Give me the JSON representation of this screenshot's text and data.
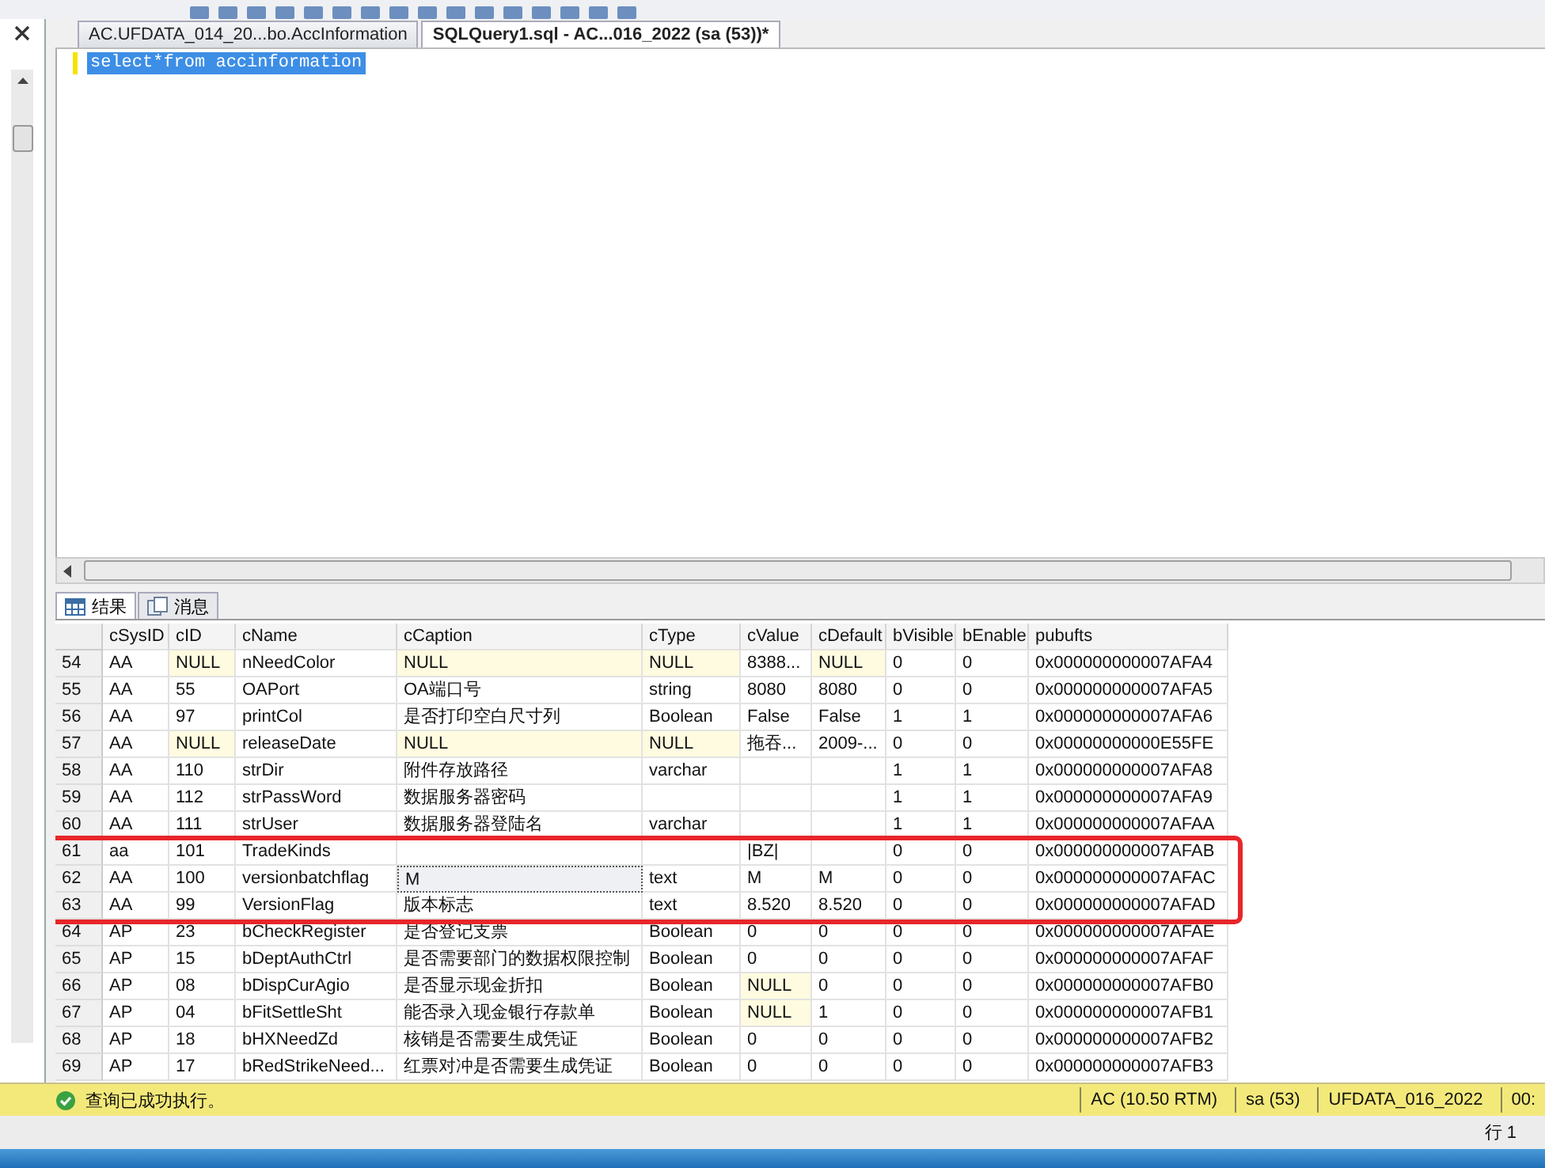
{
  "tabs": [
    {
      "label": "AC.UFDATA_014_20...bo.AccInformation",
      "selected": false
    },
    {
      "label": "SQLQuery1.sql - AC...016_2022 (sa (53))*",
      "selected": true
    }
  ],
  "editor": {
    "query": "select*from accinformation",
    "selected": true
  },
  "result_tabs": [
    {
      "label": "结果",
      "kind": "grid",
      "selected": true
    },
    {
      "label": "消息",
      "kind": "messages",
      "selected": false
    }
  ],
  "table": {
    "columns": [
      "cSysID",
      "cID",
      "cName",
      "cCaption",
      "cType",
      "cValue",
      "cDefault",
      "bVisible",
      "bEnable",
      "pubufts"
    ],
    "rows": [
      {
        "number": "54",
        "cells": [
          "AA",
          {
            "text": "NULL",
            "null": true,
            "focused": false
          },
          "nNeedColor",
          {
            "text": "NULL",
            "null": true,
            "focused": false
          },
          {
            "text": "NULL",
            "null": true,
            "focused": false
          },
          "8388...",
          {
            "text": "NULL",
            "null": true,
            "focused": false
          },
          "0",
          "0",
          "0x000000000007AFA4"
        ]
      },
      {
        "number": "55",
        "cells": [
          "AA",
          "55",
          "OAPort",
          "OA端口号",
          "string",
          "8080",
          "8080",
          "0",
          "0",
          "0x000000000007AFA5"
        ]
      },
      {
        "number": "56",
        "cells": [
          "AA",
          "97",
          "printCol",
          "是否打印空白尺寸列",
          "Boolean",
          "False",
          "False",
          "1",
          "1",
          "0x000000000007AFA6"
        ]
      },
      {
        "number": "57",
        "cells": [
          "AA",
          {
            "text": "NULL",
            "null": true,
            "focused": false
          },
          "releaseDate",
          {
            "text": "NULL",
            "null": true,
            "focused": false
          },
          {
            "text": "NULL",
            "null": true,
            "focused": false
          },
          "拖吞...",
          "2009-...",
          "0",
          "0",
          "0x00000000000E55FE"
        ]
      },
      {
        "number": "58",
        "cells": [
          "AA",
          "110",
          "strDir",
          "附件存放路径",
          "varchar",
          null,
          null,
          "1",
          "1",
          "0x000000000007AFA8"
        ]
      },
      {
        "number": "59",
        "cells": [
          "AA",
          "112",
          "strPassWord",
          "数据服务器密码",
          null,
          null,
          null,
          "1",
          "1",
          "0x000000000007AFA9"
        ]
      },
      {
        "number": "60",
        "cells": [
          "AA",
          "111",
          "strUser",
          "数据服务器登陆名",
          "varchar",
          null,
          null,
          "1",
          "1",
          "0x000000000007AFAA"
        ]
      },
      {
        "number": "61",
        "cells": [
          "aa",
          "101",
          "TradeKinds",
          null,
          null,
          "|BZ|",
          null,
          "0",
          "0",
          "0x000000000007AFAB"
        ]
      },
      {
        "number": "62",
        "cells": [
          "AA",
          "100",
          "versionbatchflag",
          {
            "text": "M",
            "focused": true
          },
          "text",
          "M",
          "M",
          "0",
          "0",
          "0x000000000007AFAC"
        ]
      },
      {
        "number": "63",
        "cells": [
          "AA",
          "99",
          "VersionFlag",
          "版本标志",
          "text",
          "8.520",
          "8.520",
          "0",
          "0",
          "0x000000000007AFAD"
        ]
      },
      {
        "number": "64",
        "cells": [
          "AP",
          "23",
          "bCheckRegister",
          "是否登记支票",
          "Boolean",
          "0",
          "0",
          "0",
          "0",
          "0x000000000007AFAE"
        ]
      },
      {
        "number": "65",
        "cells": [
          "AP",
          "15",
          "bDeptAuthCtrl",
          "是否需要部门的数据权限控制",
          "Boolean",
          "0",
          "0",
          "0",
          "0",
          "0x000000000007AFAF"
        ]
      },
      {
        "number": "66",
        "cells": [
          "AP",
          "08",
          "bDispCurAgio",
          "是否显示现金折扣",
          "Boolean",
          {
            "text": "NULL",
            "null": true,
            "focused": false
          },
          "0",
          "0",
          "0",
          "0x000000000007AFB0"
        ]
      },
      {
        "number": "67",
        "cells": [
          "AP",
          "04",
          "bFitSettleSht",
          "能否录入现金银行存款单",
          "Boolean",
          {
            "text": "NULL",
            "null": true,
            "focused": false
          },
          "1",
          "0",
          "0",
          "0x000000000007AFB1"
        ]
      },
      {
        "number": "68",
        "cells": [
          "AP",
          "18",
          "bHXNeedZd",
          "核销是否需要生成凭证",
          "Boolean",
          "0",
          "0",
          "0",
          "0",
          "0x000000000007AFB2"
        ]
      },
      {
        "number": "69",
        "cells": [
          "AP",
          "17",
          "bRedStrikeNeed...",
          "红票对冲是否需要生成凭证",
          "Boolean",
          "0",
          "0",
          "0",
          "0",
          "0x000000000007AFB3"
        ]
      }
    ]
  },
  "annotation": {
    "kind": "frame",
    "color": "#e8262a"
  },
  "status_bar": {
    "message": "查询已成功执行。",
    "segments": [
      "AC (10.50 RTM)",
      "sa (53)",
      "UFDATA_016_2022",
      "00:"
    ]
  },
  "position": "行 1"
}
